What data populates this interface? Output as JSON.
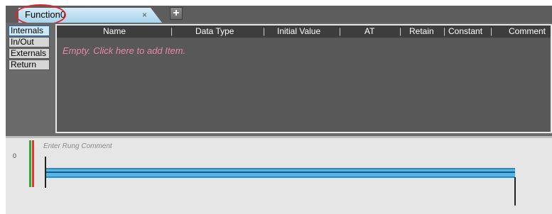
{
  "tab": {
    "title": "Function0",
    "close_glyph": "×",
    "add_glyph": "+"
  },
  "categories": {
    "items": [
      {
        "label": "Internals",
        "active": true
      },
      {
        "label": "In/Out",
        "active": false
      },
      {
        "label": "Externals",
        "active": false
      },
      {
        "label": "Return",
        "active": false
      }
    ]
  },
  "variables": {
    "columns": [
      "Name",
      "Data Type",
      "Initial Value",
      "AT",
      "Retain",
      "Constant",
      "Comment"
    ],
    "empty_text": "Empty. Click here to add Item."
  },
  "ladder": {
    "rung_number": "0",
    "rung_comment_placeholder": "Enter Rung Comment"
  },
  "colors": {
    "tab_highlight": "#e0262c",
    "rung_bar": "#54b6e2",
    "empty_text": "#e88aa8"
  }
}
